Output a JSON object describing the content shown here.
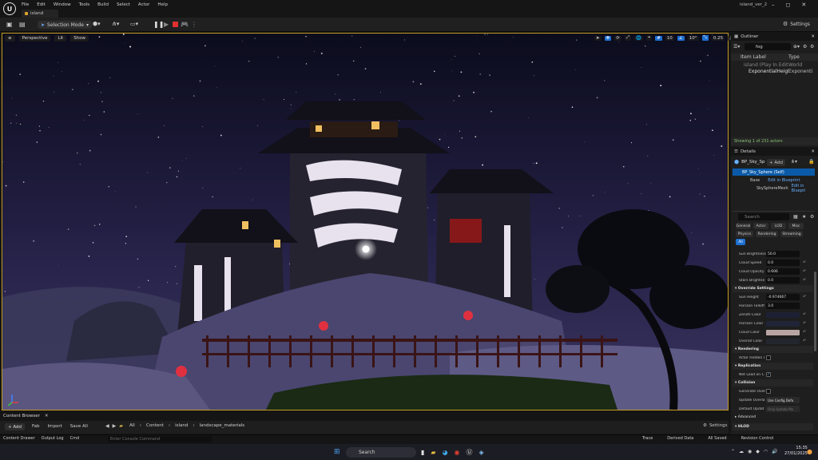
{
  "menu": [
    "File",
    "Edit",
    "Window",
    "Tools",
    "Build",
    "Select",
    "Actor",
    "Help"
  ],
  "doc_tab": "island",
  "project_name": "island_ver_2",
  "window_controls": [
    "–",
    "◻",
    "✕"
  ],
  "toolbar": {
    "selection_mode": "Selection Mode",
    "settings": "Settings"
  },
  "viewport": {
    "perspective": "Perspective",
    "lit": "Lit",
    "show": "Show",
    "grid_snap": "10",
    "rotation_snap": "10°",
    "scale_snap": "0.25",
    "camera_speed": "1"
  },
  "outliner": {
    "title": "Outliner",
    "search_value": "fog",
    "col_label": "Item Label",
    "col_type": "Type",
    "rows": [
      {
        "label": "island (Play In Editor)",
        "type": "World"
      },
      {
        "label": "ExponentialHeightFog",
        "type": "Exponenti"
      }
    ],
    "status": "Showing 1 of 231 actors"
  },
  "details": {
    "title": "Details",
    "actor_name": "BP_Sky_Sp",
    "add_label": "+ Add",
    "components": [
      {
        "label": "BP_Sky_Sphere (Self)"
      },
      {
        "label": "Base",
        "link": "Edit in Blueprint"
      },
      {
        "label": "SkySphereMesh",
        "link": "Edit in Bluepri"
      }
    ],
    "search_placeholder": "Search",
    "categories": [
      "General",
      "Actor",
      "LOD",
      "Misc",
      "Physics",
      "Rendering",
      "Streaming",
      "All"
    ],
    "props1": [
      {
        "label": "Sun Brightness",
        "value": "50.0"
      },
      {
        "label": "Cloud Speed",
        "value": "0.0"
      },
      {
        "label": "Cloud Opacity",
        "value": "0.606"
      },
      {
        "label": "Stars Brightne",
        "value": "0.0"
      }
    ],
    "override_title": "Override Settings",
    "props2": [
      {
        "label": "Sun Height",
        "value": "-0.974667"
      },
      {
        "label": "Horizon Falloff",
        "value": "3.0"
      }
    ],
    "colors": [
      {
        "label": "Zenith Color",
        "color": "#1d2033"
      },
      {
        "label": "Horizon Color",
        "color": "#202436"
      },
      {
        "label": "Cloud Color",
        "color": "#b9a4a4"
      },
      {
        "label": "Overall Color",
        "color": "#24262e"
      }
    ],
    "rendering_title": "Rendering",
    "rendering_prop": "Actor Hidden I",
    "replication_title": "Replication",
    "replication_prop": "Net Load on C",
    "collision_title": "Collision",
    "collision_props": [
      {
        "label": "Generate Over"
      },
      {
        "label": "Update Overla",
        "value": "Use Config Defa"
      },
      {
        "label": "Default Updat",
        "value": "Only Update Mo"
      }
    ],
    "advanced": "Advanced",
    "hlod": "HLOD"
  },
  "content_browser": {
    "tab": "Content Browser",
    "add": "+ Add",
    "fab": "Fab",
    "import": "Import",
    "save_all": "Save All",
    "breadcrumb": [
      "All",
      "Content",
      "island",
      "landscape_materials"
    ],
    "settings": "Settings"
  },
  "statusbar": {
    "content_drawer": "Content Drawer",
    "output_log": "Output Log",
    "cmd": "Cmd",
    "console_placeholder": "Enter Console Command",
    "trace": "Trace",
    "derived_data": "Derived Data",
    "all_saved": "All Saved",
    "revision_control": "Revision Control"
  },
  "taskbar": {
    "search": "Search",
    "time": "15:35",
    "date": "27/01/2025"
  },
  "colors": {
    "accent": "#1e6fd0",
    "viewport_border": "#c29a22",
    "status_green": "#88c070",
    "link": "#6ab0ff"
  }
}
